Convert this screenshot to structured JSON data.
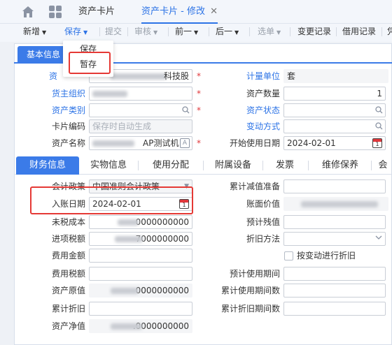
{
  "topbar": {
    "tabs": [
      {
        "label": "资产卡片"
      },
      {
        "label": "资产卡片 - 修改"
      }
    ],
    "close": "✕"
  },
  "toolbar": {
    "items": [
      {
        "label": "新增"
      },
      {
        "label": "保存"
      },
      {
        "label": "提交"
      },
      {
        "label": "审核"
      },
      {
        "label": "前一"
      },
      {
        "label": "后一"
      },
      {
        "label": "选单"
      },
      {
        "label": "变更记录"
      },
      {
        "label": "借用记录"
      },
      {
        "label": "凭"
      }
    ]
  },
  "save_menu": {
    "items": [
      {
        "label": "保存"
      },
      {
        "label": "暂存"
      }
    ]
  },
  "basic": {
    "title": "基本信息",
    "asset_org_label": "资",
    "asset_org_value": "科技股",
    "owner_org_label": "货主组织",
    "asset_category_label": "资产类别",
    "card_no_label": "卡片编码",
    "card_no_placeholder": "保存时自动生成",
    "asset_name_label": "资产名称",
    "asset_name_value": "AP测试机",
    "unit_label": "计量单位",
    "unit_value": "套",
    "qty_label": "资产数量",
    "qty_value": "1",
    "status_label": "资产状态",
    "change_mode_label": "变动方式",
    "start_date_label": "开始使用日期",
    "start_date_value": "2024-02-01"
  },
  "tabs2": {
    "items": [
      {
        "label": "财务信息"
      },
      {
        "label": "实物信息"
      },
      {
        "label": "使用分配"
      },
      {
        "label": "附属设备"
      },
      {
        "label": "发票"
      },
      {
        "label": "维修保养"
      },
      {
        "label": "会"
      }
    ]
  },
  "finance": {
    "policy_label": "会计政策",
    "policy_value": "中国准则会计政策",
    "entry_date_label": "入账日期",
    "entry_date_value": "2024-02-01",
    "pretax_cost_label": "未税成本",
    "pretax_cost_value": "0000000000",
    "input_tax_label": "进项税额",
    "input_tax_value": "7000000000",
    "expense_amount_label": "费用金额",
    "expense_tax_label": "费用税额",
    "original_value_label": "资产原值",
    "original_value_value": "0000000000",
    "accum_dep_label": "累计折旧",
    "net_value_label": "资产净值",
    "net_value_value": ".0000000000",
    "accum_impairment_label": "累计减值准备",
    "book_value_label": "账面价值",
    "residual_label": "预计残值",
    "dep_method_label": "折旧方法",
    "dep_by_change_label": "按变动进行折旧",
    "use_period_label": "预计使用期间",
    "used_period_label": "累计使用期间数",
    "dep_period_label": "累计折旧期间数"
  }
}
